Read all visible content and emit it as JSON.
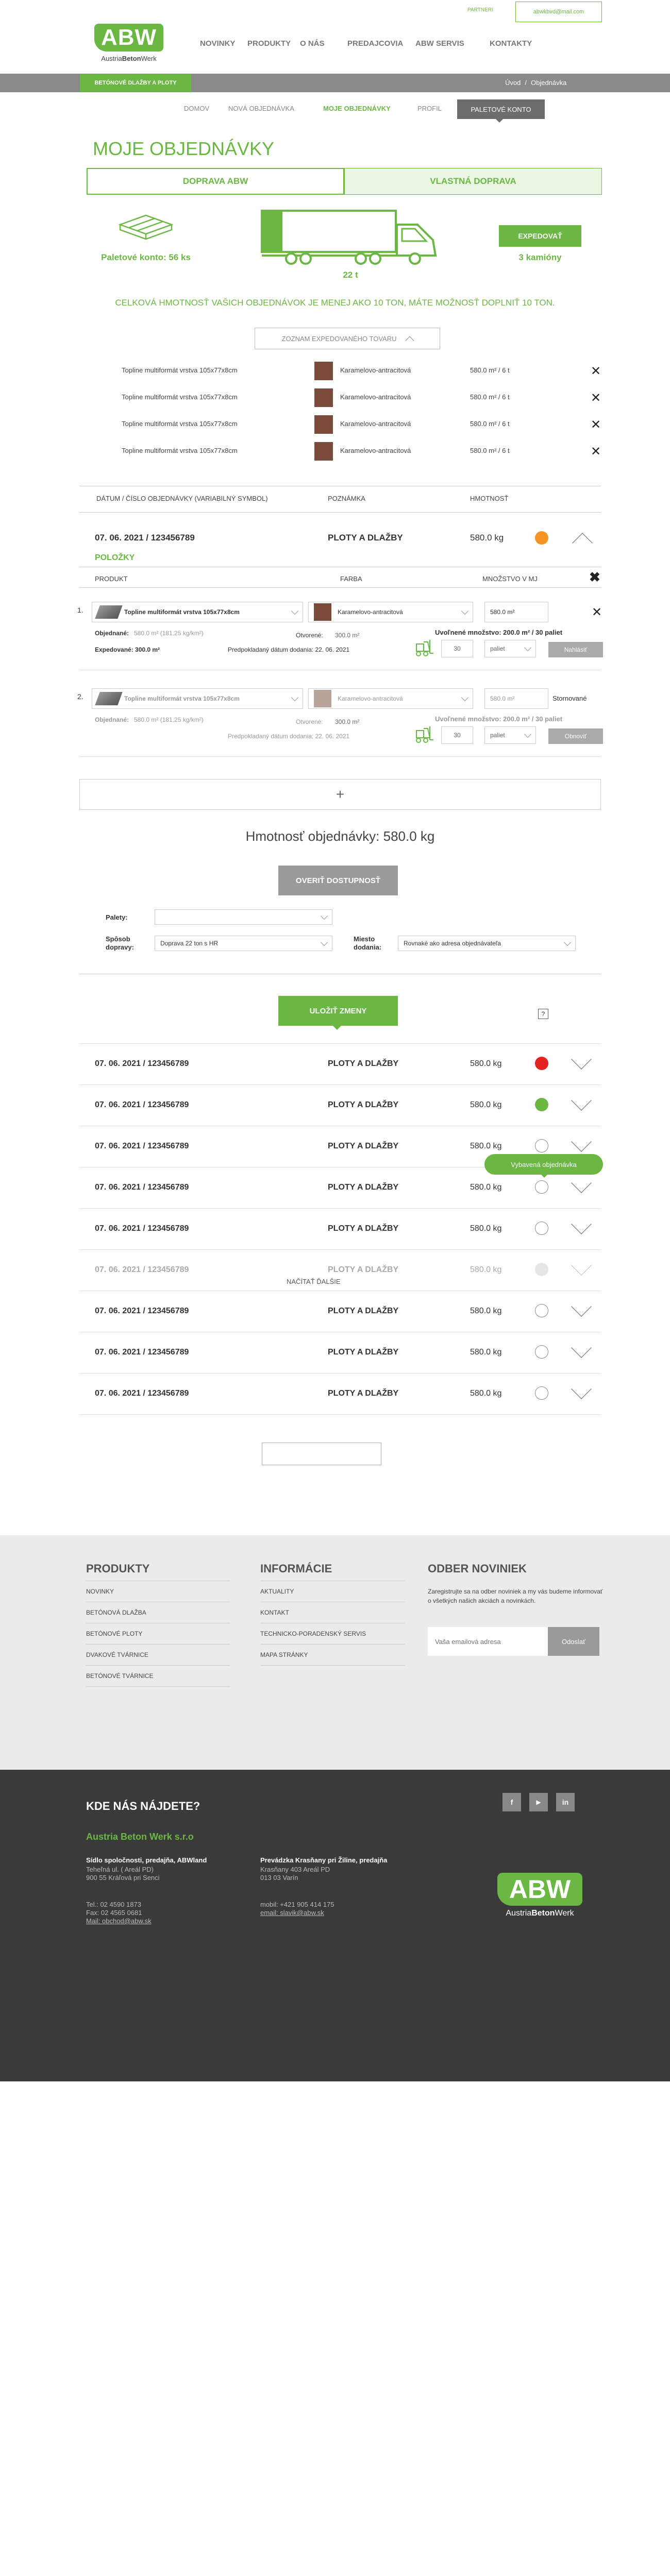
{
  "header": {
    "partners_label": "PARTNERI",
    "email": "abwkbvd@mail.com",
    "logo_letters": "ABW",
    "logo_text_1": "Austria",
    "logo_text_2": "Beton",
    "logo_text_3": "Werk",
    "nav": [
      "NOVINKY",
      "PRODUKTY",
      "O NÁS",
      "PREDAJCOVIA",
      "ABW SERVIS",
      "KONTAKTY"
    ]
  },
  "gray_bar": {
    "badge": "BETÓNOVÉ DLAŽBY A PLOTY",
    "crumb_home": "Úvod",
    "crumb_sep": "/",
    "crumb_current": "Objednávka"
  },
  "subnav": [
    "DOMOV",
    "NOVÁ OBJEDNÁVKA",
    "MOJE OBJEDNÁVKY",
    "PROFIL",
    "PALETOVÉ KONTO"
  ],
  "page_title": "MOJE OBJEDNÁVKY",
  "tabs": [
    "DOPRAVA ABW",
    "VLASTNÁ DOPRAVA"
  ],
  "summary": {
    "pallet_account": "Paletové konto: 56 ks",
    "truck_weight": "22 t",
    "truck_fill_percent": 10,
    "expedite_button": "EXPEDOVAŤ",
    "trucks_count": "3 kamióny",
    "notice": "CELKOVÁ HMOTNOSŤ VAŠICH OBJEDNÁVOK JE MENEJ AKO 10 TON, MÁTE MOŽNOSŤ DOPLNIŤ 10 TON.",
    "dropdown_label": "ZOZNAM EXPEDOVANÉHO TOVARU"
  },
  "expedited_items": [
    {
      "name": "Topline multiformát vrstva 105x77x8cm",
      "color": "Karamelovo-antracitová",
      "qty": "580.0 m² / 6 t"
    },
    {
      "name": "Topline multiformát vrstva 105x77x8cm",
      "color": "Karamelovo-antracitová",
      "qty": "580.0 m² / 6 t"
    },
    {
      "name": "Topline multiformát vrstva 105x77x8cm",
      "color": "Karamelovo-antracitová",
      "qty": "580.0 m² / 6 t"
    },
    {
      "name": "Topline multiformát vrstva 105x77x8cm",
      "color": "Karamelovo-antracitová",
      "qty": "580.0 m² / 6 t"
    }
  ],
  "orders_header": {
    "col1": "DÁTUM / ČÍSLO OBJEDNÁVKY (VARIABILNÝ SYMBOL)",
    "col2": "POZNÁMKA",
    "col3": "HMOTNOSŤ"
  },
  "expanded_order": {
    "id": "07. 06. 2021 / 123456789",
    "note": "PLOTY A DLAŽBY",
    "weight": "580.0 kg",
    "items_label": "POLOŽKY",
    "col_product": "PRODUKT",
    "col_color": "FARBA",
    "col_qty": "MNOŽSTVO V MJ",
    "items": [
      {
        "num": "1.",
        "product": "Topline multiformát vrstva 105x77x8cm",
        "color": "Karamelovo-antracitová",
        "qty": "580.0 m²",
        "ordered_label": "Objednané:",
        "ordered_value": "580.0 m² (181.25 kg/km²)",
        "confirmed_label": "Otvorené:",
        "confirmed_value": "300.0 m²",
        "released": "Uvoľnené množstvo: 200.0 m² / 30 paliet",
        "expedited": "Expedované: 300.0 m²",
        "delivery": "Predpokladaný dátum dodania: 22. 06. 2021",
        "pallets": "30",
        "unit": "paliet",
        "action": "Nahlásiť",
        "status": ""
      },
      {
        "num": "2.",
        "product": "Topline multiformát vrstva 105x77x8cm",
        "color": "Karamelovo-antracitová",
        "qty": "580.0 m²",
        "ordered_label": "Objednané:",
        "ordered_value": "580.0 m² (181.25 kg/km²)",
        "confirmed_label": "Otvorené:",
        "confirmed_value": "300.0 m²",
        "released": "Uvoľnené množstvo: 200.0 m² / 30 paliet",
        "expedited": "",
        "delivery": "Predpokladaný dátum dodania: 22. 06. 2021",
        "pallets": "30",
        "unit": "paliet",
        "action": "Obnoviť",
        "status": "Stornované"
      }
    ],
    "add_symbol": "+",
    "total_weight": "Hmotnosť objednávky: 580.0 kg",
    "check_button": "OVERIŤ DOSTUPNOSŤ",
    "pallets_label": "Palety:",
    "transport_label": "Spôsob dopravy:",
    "transport_value": "Doprava 22 ton s HR",
    "place_label": "Miesto dodania:",
    "place_value": "Rovnaké ako adresa objednávateľa",
    "save_button": "ULOŽIŤ ZMENY",
    "help_symbol": "?"
  },
  "orders": [
    {
      "id": "07. 06. 2021 / 123456789",
      "note": "PLOTY A DLAŽBY",
      "weight": "580.0 kg",
      "status": "red",
      "faded": false
    },
    {
      "id": "07. 06. 2021 / 123456789",
      "note": "PLOTY A DLAŽBY",
      "weight": "580.0 kg",
      "status": "green",
      "faded": false
    },
    {
      "id": "07. 06. 2021 / 123456789",
      "note": "PLOTY A DLAŽBY",
      "weight": "580.0 kg",
      "status": "empty",
      "faded": false
    },
    {
      "id": "07. 06. 2021 / 123456789",
      "note": "PLOTY A DLAŽBY",
      "weight": "580.0 kg",
      "status": "empty",
      "faded": false
    },
    {
      "id": "07. 06. 2021 / 123456789",
      "note": "PLOTY A DLAŽBY",
      "weight": "580.0 kg",
      "status": "empty",
      "faded": false
    },
    {
      "id": "07. 06. 2021 / 123456789",
      "note": "PLOTY A DLAŽBY",
      "weight": "580.0 kg",
      "status": "light",
      "faded": true
    },
    {
      "id": "07. 06. 2021 / 123456789",
      "note": "PLOTY A DLAŽBY",
      "weight": "580.0 kg",
      "status": "empty",
      "faded": false
    },
    {
      "id": "07. 06. 2021 / 123456789",
      "note": "PLOTY A DLAŽBY",
      "weight": "580.0 kg",
      "status": "empty",
      "faded": false
    },
    {
      "id": "07. 06. 2021 / 123456789",
      "note": "PLOTY A DLAŽBY",
      "weight": "580.0 kg",
      "status": "empty",
      "faded": false
    }
  ],
  "tooltip": "Vybavená objednávka",
  "load_more": "NAČÍTAŤ ĎALŠIE",
  "footer": {
    "products_title": "PRODUKTY",
    "products": [
      "NOVINKY",
      "BETÓNOVÁ DLAŽBA",
      "BETÓNOVÉ PLOTY",
      "DVAKOVÉ TVÁRNICE",
      "BETÓNOVÉ TVÁRNICE"
    ],
    "info_title": "INFORMÁCIE",
    "info": [
      "AKTUALITY",
      "KONTAKT",
      "TECHNICKO-PORADENSKÝ SERVIS",
      "MAPA STRÁNKY"
    ],
    "newsletter_title": "ODBER NOVINIEK",
    "newsletter_text": "Zaregistrujte sa na odber noviniek a my vás budeme informovať o všetkých našich akciách a novinkách.",
    "email_placeholder": "Vaša emailová adresa",
    "subscribe": "Odoslať",
    "find_us": "KDE NÁS NÁJDETE?",
    "company": "Austria Beton Werk s.r.o",
    "addr1_title": "Sídlo spoločnosti, predajňa, ABWland",
    "addr1_lines": [
      "Teheľná ul. ( Areál PD)",
      "900 55 Kráľová pri Senci"
    ],
    "contact1": [
      "Tel.: 02 4590 1873",
      "Fax: 02 4565 0681",
      "Mail: obchod@abw.sk"
    ],
    "addr2_title": "Prevádzka Krasňany pri Žiline, predajňa",
    "addr2_lines": [
      "Krasňany 403 Areál PD",
      "013 03 Varín"
    ],
    "contact2": [
      "mobil: +421 905 414 175",
      "email: slavik@abw.sk"
    ],
    "social": [
      "f",
      "▶",
      "in"
    ]
  }
}
